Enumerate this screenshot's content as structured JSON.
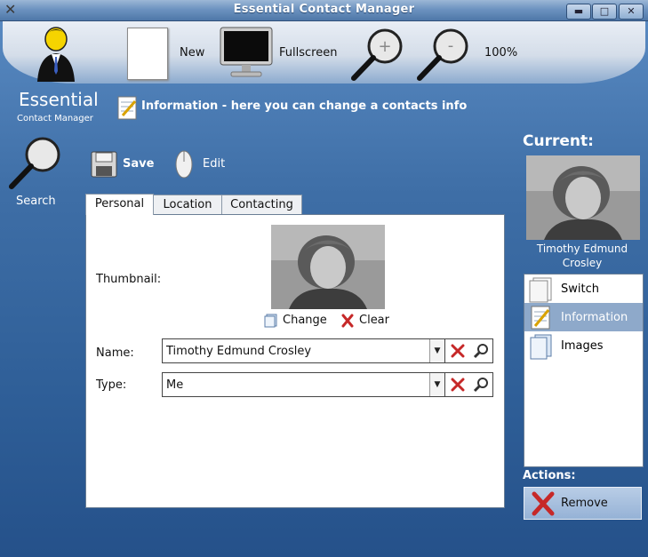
{
  "window": {
    "title": "Essential Contact Manager",
    "minimize": "▬",
    "maximize": "□",
    "close": "✕"
  },
  "app_icon": "x-app-icon",
  "toolbar": {
    "new_label": "New",
    "fullscreen_label": "Fullscreen",
    "zoom_label": "100%"
  },
  "brand": {
    "title": "Essential",
    "subtitle": "Contact Manager"
  },
  "info_heading": "Information - here you can change a contacts info",
  "search_label": "Search",
  "actions_bar": {
    "save_label": "Save",
    "edit_label": "Edit"
  },
  "tabs": [
    {
      "label": "Personal",
      "active": true
    },
    {
      "label": "Location",
      "active": false
    },
    {
      "label": "Contacting",
      "active": false
    }
  ],
  "form": {
    "thumbnail_label": "Thumbnail:",
    "change_label": "Change",
    "clear_label": "Clear",
    "name_label": "Name:",
    "name_value": "Timothy Edmund Crosley",
    "type_label": "Type:",
    "type_value": "Me"
  },
  "current": {
    "heading": "Current:",
    "name": "Timothy Edmund Crosley"
  },
  "side_items": [
    {
      "label": "Switch",
      "selected": false
    },
    {
      "label": "Information",
      "selected": true
    },
    {
      "label": "Images",
      "selected": false
    }
  ],
  "actions": {
    "heading": "Actions:",
    "remove_label": "Remove"
  },
  "colors": {
    "accent": "#8ea9ca",
    "danger": "#c62828",
    "background": "#3e6ea6"
  }
}
